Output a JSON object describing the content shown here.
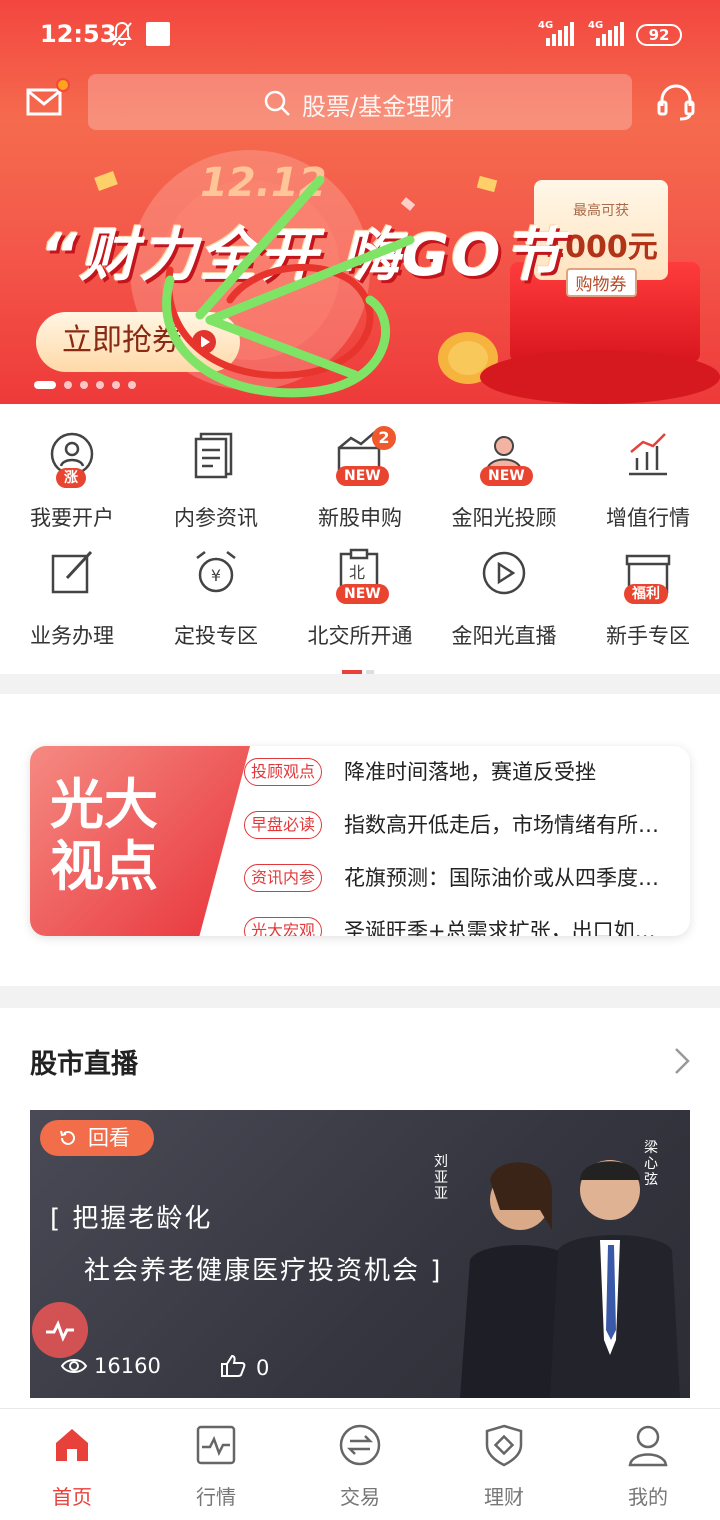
{
  "status_bar": {
    "time": "12:53",
    "network_1": "4G",
    "network_2": "4G",
    "battery": "92"
  },
  "header": {
    "search_placeholder": "股票/基金理财"
  },
  "banner": {
    "date": "12.12",
    "title": "“财力全开 嗨GO节",
    "cta": "立即抢券",
    "coupon": {
      "caption": "最高可获",
      "amount": "1000元",
      "label": "购物券"
    },
    "page_count": 6,
    "active_page": 1
  },
  "quick_menu": [
    {
      "label": "我要开户",
      "icon": "open-account-icon",
      "badge": "涨"
    },
    {
      "label": "内参资讯",
      "icon": "news-doc-icon"
    },
    {
      "label": "新股申购",
      "icon": "ipo-chart-icon",
      "badge": "NEW",
      "count": "2"
    },
    {
      "label": "金阳光投顾",
      "icon": "advisor-icon",
      "badge": "NEW"
    },
    {
      "label": "增值行情",
      "icon": "market-chart-icon"
    },
    {
      "label": "业务办理",
      "icon": "edit-icon"
    },
    {
      "label": "定投专区",
      "icon": "alarm-clock-icon"
    },
    {
      "label": "北交所开通",
      "icon": "bse-clipboard-icon",
      "badge": "NEW"
    },
    {
      "label": "金阳光直播",
      "icon": "play-circle-icon"
    },
    {
      "label": "新手专区",
      "icon": "gift-icon",
      "badge": "福利"
    }
  ],
  "viewpoint": {
    "title": "光大视点",
    "items": [
      {
        "tag": "投顾观点",
        "text": "降准时间落地，赛道反受挫"
      },
      {
        "tag": "早盘必读",
        "text": "指数高开低走后，市场情绪有所…"
      },
      {
        "tag": "资讯内参",
        "text": "花旗预测：国际油价或从四季度…"
      },
      {
        "tag": "光大宏观",
        "text": "圣诞旺季+总需求扩张，出口如…"
      }
    ]
  },
  "live": {
    "title": "股市直播",
    "replay_label": "回看",
    "headline_1": "[ 把握老龄化",
    "headline_2": "社会养老健康医疗投资机会 ]",
    "host_left": "刘亚亚",
    "host_right": "梁心弦",
    "views": "16160",
    "likes": "0"
  },
  "tabs": [
    {
      "label": "首页",
      "active": true
    },
    {
      "label": "行情"
    },
    {
      "label": "交易"
    },
    {
      "label": "理财"
    },
    {
      "label": "我的"
    }
  ],
  "colors": {
    "brand_red": "#e8403a",
    "tag_red": "#e1393b",
    "orange": "#ee5a2d"
  }
}
